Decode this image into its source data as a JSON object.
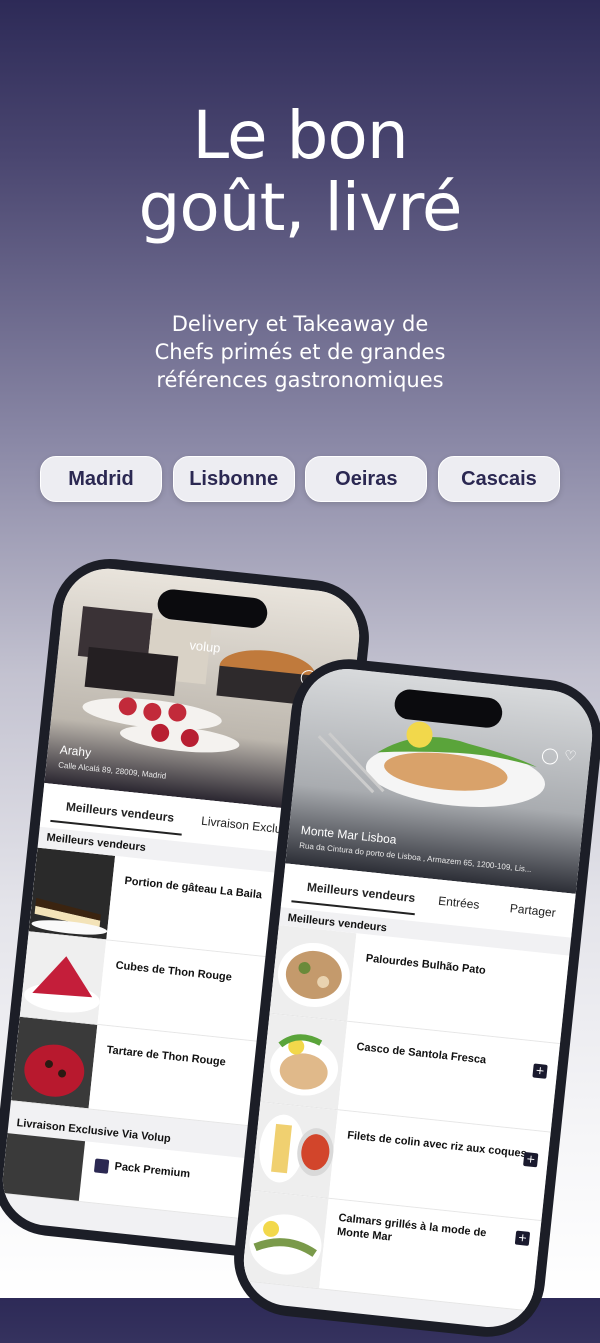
{
  "hero": {
    "title_line1": "Le bon",
    "title_line2": "goût, livré",
    "subtitle_line1": "Delivery et Takeaway de",
    "subtitle_line2": "Chefs primés et de grandes",
    "subtitle_line3": "références gastronomiques"
  },
  "cities": [
    "Madrid",
    "Lisbonne",
    "Oeiras",
    "Cascais"
  ],
  "phone_left": {
    "brand": "volup",
    "restaurant_name": "Arahy",
    "restaurant_address": "Calle Alcalá 89, 28009, Madrid",
    "tabs": [
      "Meilleurs vendeurs",
      "Livraison Exclu"
    ],
    "section_title": "Meilleurs vendeurs",
    "items": [
      "Portion de gâteau La Baila",
      "Cubes de Thon Rouge",
      "Tartare de Thon Rouge"
    ],
    "section2_title": "Livraison Exclusive Via Volup",
    "pack_label": "Pack Premium"
  },
  "phone_right": {
    "restaurant_name": "Monte Mar Lisboa",
    "restaurant_address": "Rua da Cintura do porto de Lisboa , Armazem 65, 1200-109, Lis...",
    "tabs": [
      "Meilleurs vendeurs",
      "Entrées",
      "Partager"
    ],
    "section_title": "Meilleurs vendeurs",
    "items": [
      "Palourdes Bulhão Pato",
      "Casco de Santola Fresca",
      "Filets de colin avec riz aux coques",
      "Calmars grillés à la mode de",
      "Monte Mar"
    ],
    "add_label": "+"
  },
  "colors": {
    "brand_dark": "#2b2852",
    "button_bg": "#ededf2"
  }
}
